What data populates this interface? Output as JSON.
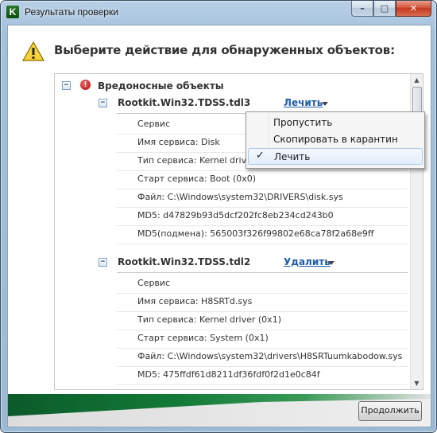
{
  "window": {
    "title": "Результаты проверки",
    "minimize_glyph": "–",
    "maximize_glyph": "□",
    "close_glyph": "✕",
    "app_icon_letter": "K"
  },
  "heading": "Выберите действие для обнаруженных объектов:",
  "group": {
    "label": "Вредоносные объекты",
    "collapse_glyph": "−",
    "error_glyph": "!"
  },
  "threats": [
    {
      "name": "Rootkit.Win32.TDSS.tdl3",
      "action": "Лечить",
      "details": [
        "Сервис",
        "Имя сервиса: Disk",
        "Тип сервиса: Kernel driver (0x1)",
        "Старт сервиса: Boot (0x0)",
        "Файл: C:\\Windows\\system32\\DRIVERS\\disk.sys",
        "MD5: d47829b93d5dcf202fc8eb234cd243b0",
        "MD5(подмена): 565003f326f99802e68ca78f2a68e9ff"
      ]
    },
    {
      "name": "Rootkit.Win32.TDSS.tdl2",
      "action": "Удалить",
      "details": [
        "Сервис",
        "Имя сервиса: H8SRTd.sys",
        "Тип сервиса: Kernel driver (0x1)",
        "Старт сервиса: System (0x1)",
        "Файл: C:\\Windows\\system32\\drivers\\H8SRTuumkabodow.sys",
        "MD5: 475ffdf61d8211df36fdf0f2d1e0c84f"
      ]
    }
  ],
  "action_menu": {
    "items": [
      "Пропустить",
      "Скопировать в карантин",
      "Лечить"
    ],
    "selected_index": 2,
    "check_glyph": "✓"
  },
  "scrollbar": {
    "up_glyph": "▲",
    "down_glyph": "▼"
  },
  "footer": {
    "continue_label": "Продолжить",
    "grip_glyph": "⋰"
  },
  "colors": {
    "link": "#1e5ca8",
    "accent_green": "#127a36",
    "error_red": "#b40000"
  }
}
